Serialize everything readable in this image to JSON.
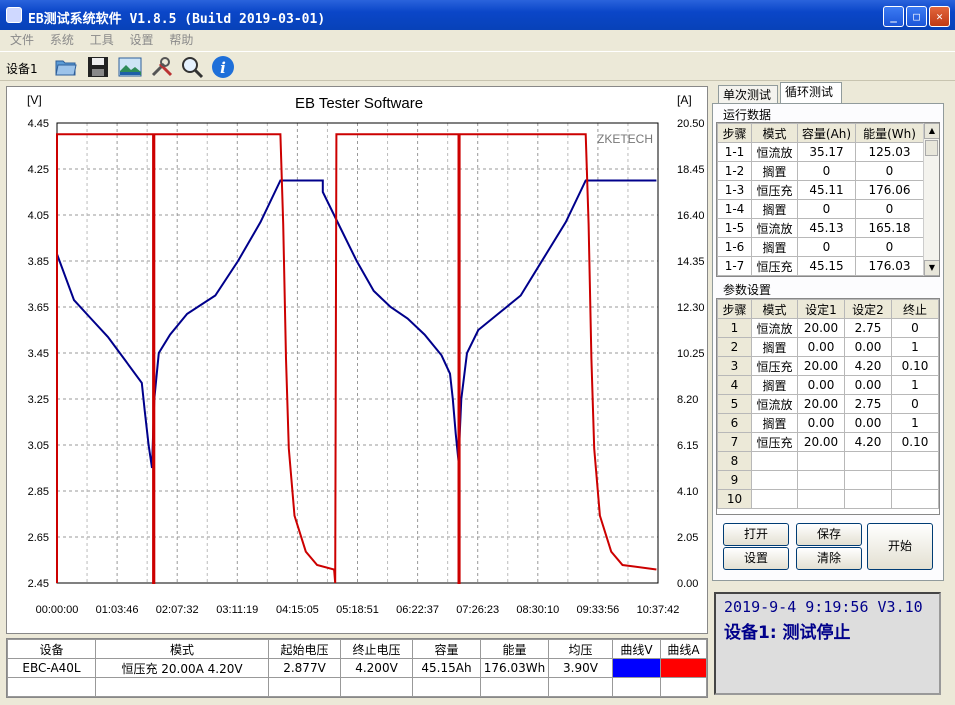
{
  "window": {
    "title": "EB测试系统软件 V1.8.5 (Build 2019-03-01)"
  },
  "menu": [
    "文件",
    "系统",
    "工具",
    "设置",
    "帮助"
  ],
  "toolbar": {
    "device_label": "设备1"
  },
  "chart_data": {
    "type": "line",
    "title": "EB Tester Software",
    "watermark": "ZKETECH",
    "left_unit": "[V]",
    "right_unit": "[A]",
    "y_left_ticks": [
      "4.45",
      "4.25",
      "4.05",
      "3.85",
      "3.65",
      "3.45",
      "3.25",
      "3.05",
      "2.85",
      "2.65",
      "2.45"
    ],
    "y_right_ticks": [
      "20.50",
      "18.45",
      "16.40",
      "14.35",
      "12.30",
      "10.25",
      "8.20",
      "6.15",
      "4.10",
      "2.05",
      "0.00"
    ],
    "x_ticks": [
      "00:00:00",
      "01:03:46",
      "02:07:32",
      "03:11:19",
      "04:15:05",
      "05:18:51",
      "06:22:37",
      "07:26:23",
      "08:30:10",
      "09:33:56",
      "10:37:42"
    ],
    "ylim_left": [
      2.45,
      4.45
    ],
    "ylim_right": [
      0,
      20.5
    ],
    "xlim_hours": [
      0,
      10.628
    ],
    "series": [
      {
        "axis": "left",
        "color": "#00008B",
        "points": [
          [
            0,
            3.88
          ],
          [
            0.3,
            3.68
          ],
          [
            0.6,
            3.6
          ],
          [
            0.9,
            3.52
          ],
          [
            1.2,
            3.42
          ],
          [
            1.5,
            3.32
          ],
          [
            1.55,
            3.2
          ],
          [
            1.62,
            3.05
          ],
          [
            1.68,
            2.95
          ],
          [
            1.72,
            3.25
          ],
          [
            1.8,
            3.45
          ],
          [
            2.0,
            3.53
          ],
          [
            2.3,
            3.62
          ],
          [
            2.8,
            3.7
          ],
          [
            3.2,
            3.85
          ],
          [
            3.6,
            4.02
          ],
          [
            3.95,
            4.2
          ],
          [
            4.7,
            4.2
          ],
          [
            4.7,
            4.15
          ],
          [
            5.0,
            4.0
          ],
          [
            5.3,
            3.85
          ],
          [
            5.6,
            3.72
          ],
          [
            5.9,
            3.65
          ],
          [
            6.2,
            3.6
          ],
          [
            6.5,
            3.53
          ],
          [
            6.8,
            3.44
          ],
          [
            6.95,
            3.36
          ],
          [
            7.0,
            3.25
          ],
          [
            7.05,
            3.1
          ],
          [
            7.1,
            2.98
          ],
          [
            7.15,
            3.25
          ],
          [
            7.25,
            3.45
          ],
          [
            7.45,
            3.55
          ],
          [
            7.8,
            3.62
          ],
          [
            8.2,
            3.7
          ],
          [
            8.6,
            3.86
          ],
          [
            9.0,
            4.02
          ],
          [
            9.35,
            4.2
          ],
          [
            10.6,
            4.2
          ]
        ]
      },
      {
        "axis": "right",
        "color": "#CC0000",
        "points": [
          [
            0,
            0
          ],
          [
            0,
            20
          ],
          [
            1.7,
            20
          ],
          [
            1.7,
            0
          ],
          [
            1.72,
            0
          ],
          [
            1.72,
            20
          ],
          [
            3.95,
            20
          ],
          [
            4.0,
            16
          ],
          [
            4.05,
            10
          ],
          [
            4.1,
            6
          ],
          [
            4.2,
            3
          ],
          [
            4.4,
            1.4
          ],
          [
            4.6,
            0.8
          ],
          [
            4.9,
            0.6
          ],
          [
            4.92,
            0
          ],
          [
            4.94,
            20
          ],
          [
            7.1,
            20
          ],
          [
            7.1,
            0
          ],
          [
            7.12,
            0
          ],
          [
            7.12,
            20
          ],
          [
            9.35,
            20
          ],
          [
            9.4,
            16
          ],
          [
            9.45,
            10
          ],
          [
            9.5,
            6
          ],
          [
            9.6,
            3
          ],
          [
            9.8,
            1.4
          ],
          [
            10.0,
            0.8
          ],
          [
            10.6,
            0.6
          ]
        ]
      }
    ]
  },
  "summary": {
    "headers": [
      "设备",
      "模式",
      "起始电压",
      "终止电压",
      "容量",
      "能量",
      "均压",
      "曲线V",
      "曲线A"
    ],
    "row": [
      "EBC-A40L",
      "恒压充  20.00A  4.20V",
      "2.877V",
      "4.200V",
      "45.15Ah",
      "176.03Wh",
      "3.90V"
    ],
    "curve_v_color": "#0000FF",
    "curve_a_color": "#FF0000"
  },
  "tabs": [
    "单次测试",
    "循环测试"
  ],
  "run_data": {
    "title": "运行数据",
    "headers": [
      "步骤",
      "模式",
      "容量(Ah)",
      "能量(Wh)"
    ],
    "rows": [
      [
        "1-1",
        "恒流放",
        "35.17",
        "125.03"
      ],
      [
        "1-2",
        "搁置",
        "0",
        "0"
      ],
      [
        "1-3",
        "恒压充",
        "45.11",
        "176.06"
      ],
      [
        "1-4",
        "搁置",
        "0",
        "0"
      ],
      [
        "1-5",
        "恒流放",
        "45.13",
        "165.18"
      ],
      [
        "1-6",
        "搁置",
        "0",
        "0"
      ],
      [
        "1-7",
        "恒压充",
        "45.15",
        "176.03"
      ]
    ]
  },
  "params": {
    "title": "参数设置",
    "headers": [
      "步骤",
      "模式",
      "设定1",
      "设定2",
      "终止"
    ],
    "rows": [
      [
        "1",
        "恒流放",
        "20.00",
        "2.75",
        "0"
      ],
      [
        "2",
        "搁置",
        "0.00",
        "0.00",
        "1"
      ],
      [
        "3",
        "恒压充",
        "20.00",
        "4.20",
        "0.10"
      ],
      [
        "4",
        "搁置",
        "0.00",
        "0.00",
        "1"
      ],
      [
        "5",
        "恒流放",
        "20.00",
        "2.75",
        "0"
      ],
      [
        "6",
        "搁置",
        "0.00",
        "0.00",
        "1"
      ],
      [
        "7",
        "恒压充",
        "20.00",
        "4.20",
        "0.10"
      ],
      [
        "8",
        "",
        "",
        "",
        ""
      ],
      [
        "9",
        "",
        "",
        "",
        ""
      ],
      [
        "10",
        "",
        "",
        "",
        ""
      ]
    ]
  },
  "buttons": {
    "open": "打开",
    "save": "保存",
    "settings": "设置",
    "clear": "清除",
    "start": "开始"
  },
  "status": {
    "line1": "2019-9-4 9:19:56  V3.10",
    "line2": "设备1: 测试停止"
  }
}
